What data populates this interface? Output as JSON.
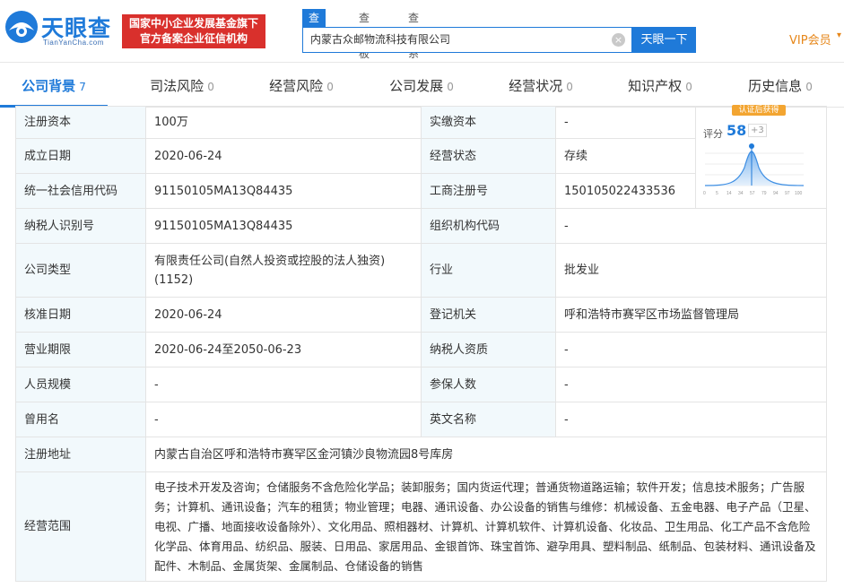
{
  "header": {
    "logo_cn": "天眼查",
    "logo_en": "TianYanCha.com",
    "badge_line1": "国家中小企业发展基金旗下",
    "badge_line2": "官方备案企业征信机构",
    "search_tabs": [
      "查公司",
      "查老板",
      "查关系"
    ],
    "search_value": "内蒙古众邮物流科技有限公司",
    "search_button": "天眼一下",
    "vip_label": "VIP会员"
  },
  "tabs": [
    {
      "label": "公司背景",
      "count": "7"
    },
    {
      "label": "司法风险",
      "count": "0"
    },
    {
      "label": "经营风险",
      "count": "0"
    },
    {
      "label": "公司发展",
      "count": "0"
    },
    {
      "label": "经营状况",
      "count": "0"
    },
    {
      "label": "知识产权",
      "count": "0"
    },
    {
      "label": "历史信息",
      "count": "0"
    }
  ],
  "rating": {
    "tag": "认证后获得",
    "label": "评分",
    "score": "58",
    "delta": "+3",
    "axis_ticks": [
      "0",
      "5",
      "14",
      "34",
      "57",
      "79",
      "94",
      "97",
      "100"
    ]
  },
  "info": {
    "registered_capital_label": "注册资本",
    "registered_capital": "100万",
    "paid_capital_label": "实缴资本",
    "paid_capital": "-",
    "founded_label": "成立日期",
    "founded": "2020-06-24",
    "status_label": "经营状态",
    "status": "存续",
    "credit_code_label": "统一社会信用代码",
    "credit_code": "91150105MA13Q84435",
    "reg_no_label": "工商注册号",
    "reg_no": "150105022433536",
    "taxpayer_id_label": "纳税人识别号",
    "taxpayer_id": "91150105MA13Q84435",
    "org_code_label": "组织机构代码",
    "org_code": "-",
    "company_type_label": "公司类型",
    "company_type": "有限责任公司(自然人投资或控股的法人独资)(1152)",
    "industry_label": "行业",
    "industry": "批发业",
    "approval_date_label": "核准日期",
    "approval_date": "2020-06-24",
    "authority_label": "登记机关",
    "authority": "呼和浩特市赛罕区市场监督管理局",
    "term_label": "营业期限",
    "term": "2020-06-24至2050-06-23",
    "taxpayer_qual_label": "纳税人资质",
    "taxpayer_qual": "-",
    "staff_label": "人员规模",
    "staff": "-",
    "insured_label": "参保人数",
    "insured": "-",
    "former_name_label": "曾用名",
    "former_name": "-",
    "english_name_label": "英文名称",
    "english_name": "-",
    "address_label": "注册地址",
    "address": "内蒙古自治区呼和浩特市赛罕区金河镇沙良物流园8号库房",
    "scope_label": "经营范围",
    "scope": "电子技术开发及咨询；仓储服务不含危险化学品；装卸服务；国内货运代理；普通货物道路运输；软件开发；信息技术服务；广告服务；计算机、通讯设备；汽车的租赁；物业管理；电器、通讯设备、办公设备的销售与维修：机械设备、五金电器、电子产品（卫星、电视、广播、地面接收设备除外）、文化用品、照相器材、计算机、计算机软件、计算机设备、化妆品、卫生用品、化工产品不含危险化学品、体育用品、纺织品、服装、日用品、家居用品、金银首饰、珠宝首饰、避孕用具、塑料制品、纸制品、包装材料、通讯设备及配件、木制品、金属货架、金属制品、仓储设备的销售"
  },
  "colors": {
    "brand": "#1f7ad9",
    "badge": "#d9302c",
    "vip": "#e6871a",
    "label_bg": "#f2f9fc"
  }
}
